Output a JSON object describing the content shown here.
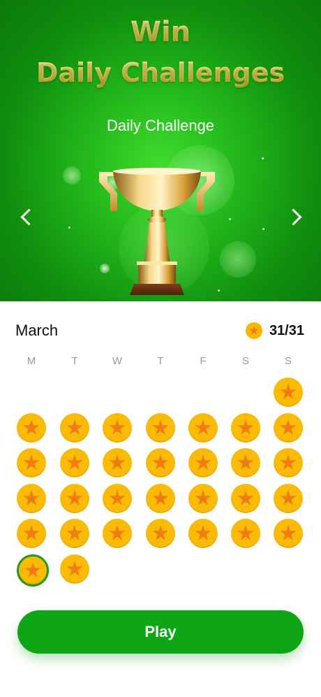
{
  "hero": {
    "title_line1": "Win",
    "title_line2": "Daily Challenges",
    "subtitle": "Daily Challenge",
    "prev_icon": "chevron-left-icon",
    "next_icon": "chevron-right-icon",
    "trophy_icon": "trophy-icon",
    "background_color": "#1cae18",
    "title_color": "#f4cf55"
  },
  "calendar": {
    "month": "March",
    "score": "31/31",
    "score_icon": "star-coin-icon",
    "weekdays": [
      "M",
      "T",
      "W",
      "T",
      "F",
      "S",
      "S"
    ],
    "first_day_column": 7,
    "days_completed": 31,
    "total_days": 31,
    "today": 30,
    "coin_color": "#fbbb05",
    "star_color": "#f07d13",
    "today_ring_color": "#1f9d18"
  },
  "play_button": {
    "label": "Play",
    "color": "#0fa615"
  }
}
